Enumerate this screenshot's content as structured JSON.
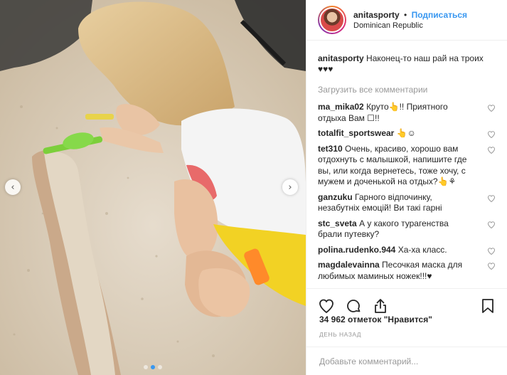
{
  "header": {
    "username": "anitasporty",
    "separator": "•",
    "follow_label": "Подписаться",
    "location": "Dominican Republic"
  },
  "caption": {
    "username": "anitasporty",
    "text": "Наконец-то наш рай на троих ♥♥♥"
  },
  "load_more_label": "Загрузить все комментарии",
  "comments": [
    {
      "username": "ma_mika02",
      "text": "Круто👆!! Приятного отдыха Вам ☐!!"
    },
    {
      "username": "totalfit_sportswear",
      "text": "👆☺"
    },
    {
      "username": "tet310",
      "text": "Очень, красиво, хорошо вам отдохнуть с малышкой, напишите где вы, или когда вернетесь, тоже хочу, с мужем и доченькой на отдых?👆⚘"
    },
    {
      "username": "ganzuku",
      "text": "Гарного відпочинку, незабутніх емоцій! Ви такі гарні"
    },
    {
      "username": "stc_sveta",
      "text": "А у какого турагенства брали путевку?"
    },
    {
      "username": "polina.rudenko.944",
      "text": "Ха-ха класс."
    },
    {
      "username": "magdalevainna",
      "text": "Песочкая маска для любимых маминых ножек!!!♥"
    }
  ],
  "likes_text": "34 962 отметок \"Нравится\"",
  "time_ago": "ДЕНЬ НАЗАД",
  "add_comment_placeholder": "Добавьте комментарий...",
  "carousel": {
    "prev_arrow": "‹",
    "next_arrow": "›",
    "dot_count": 3,
    "active_dot": 1
  },
  "icons": {
    "like": "heart-icon",
    "comment": "comment-icon",
    "share": "share-icon",
    "save": "bookmark-icon"
  },
  "colors": {
    "link_blue": "#3897f0",
    "muted": "#999999",
    "text": "#262626"
  }
}
